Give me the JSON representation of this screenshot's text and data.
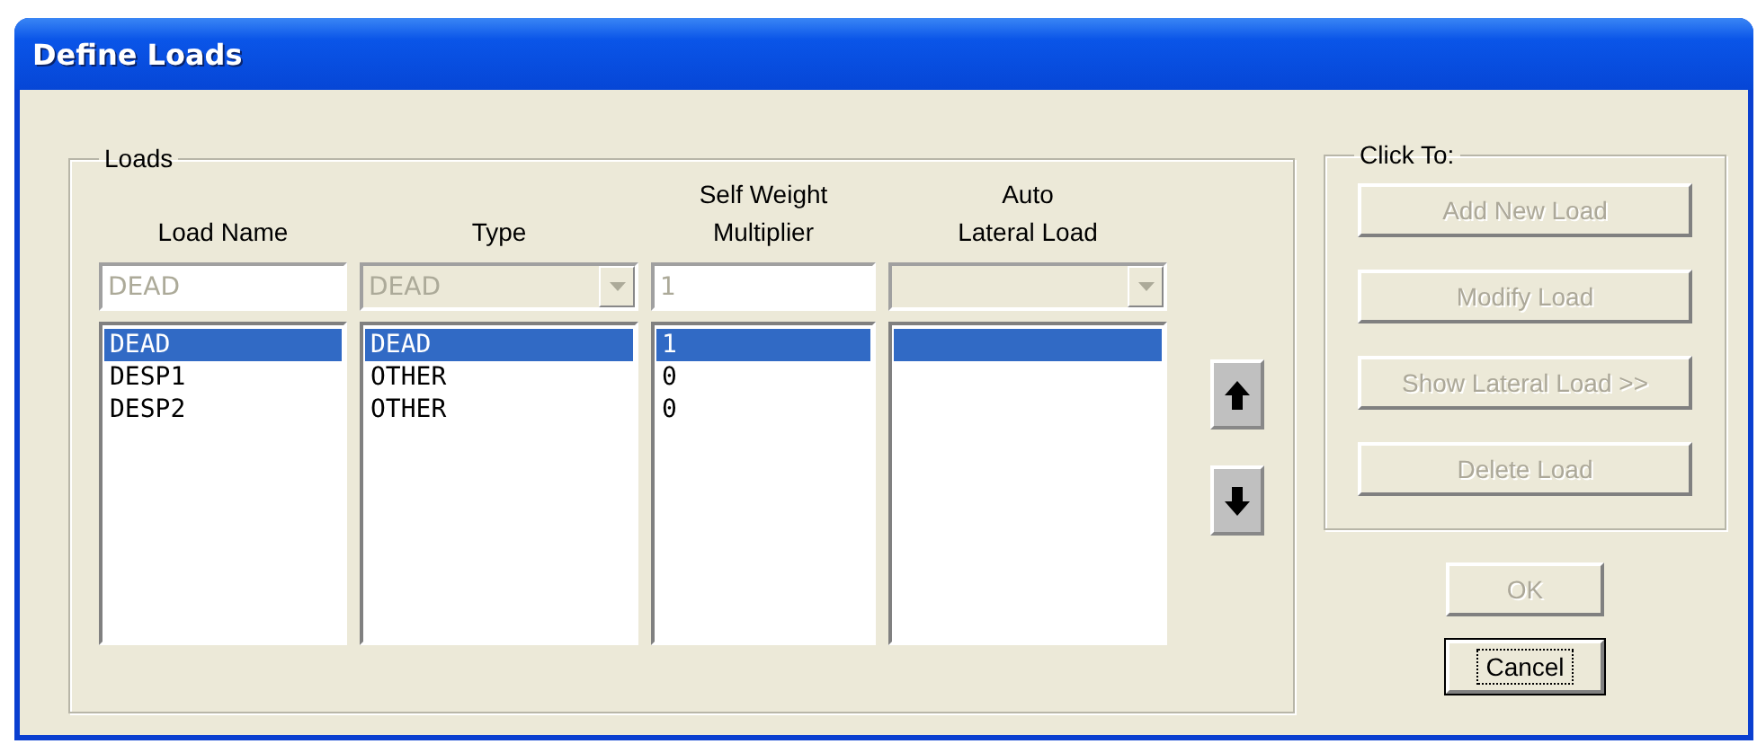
{
  "window": {
    "title": "Define Loads"
  },
  "loads": {
    "legend": "Loads",
    "columns": [
      {
        "header": [
          "Load Name"
        ],
        "kind": "text",
        "value": "DEAD"
      },
      {
        "header": [
          "Type"
        ],
        "kind": "combo",
        "value": "DEAD"
      },
      {
        "header": [
          "Self Weight",
          "Multiplier"
        ],
        "kind": "text",
        "value": "1"
      },
      {
        "header": [
          "Auto",
          "Lateral Load"
        ],
        "kind": "combo"
      }
    ],
    "rows": [
      {
        "cells": [
          "DEAD",
          "DEAD",
          "1"
        ],
        "selected": true
      },
      {
        "cells": [
          "DESP1",
          "OTHER",
          "0"
        ],
        "selected": false
      },
      {
        "cells": [
          "DESP2",
          "OTHER",
          "0"
        ],
        "selected": false
      }
    ]
  },
  "click_to": {
    "legend": "Click To:",
    "buttons": [
      {
        "label": "Add New Load",
        "disabled": true
      },
      {
        "label": "Modify Load",
        "disabled": true
      },
      {
        "label": "Show Lateral Load >>",
        "disabled": true
      },
      {
        "label": "Delete Load",
        "disabled": true
      }
    ]
  },
  "dialog_buttons": [
    {
      "label": "OK",
      "disabled": true,
      "focused": false
    },
    {
      "label": "Cancel",
      "disabled": false,
      "focused": true
    }
  ]
}
